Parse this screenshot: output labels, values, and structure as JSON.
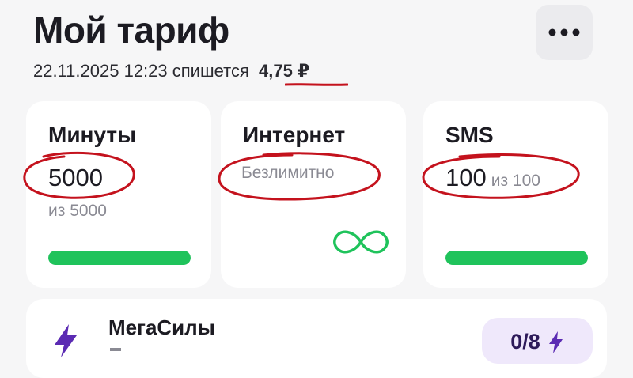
{
  "header": {
    "title": "Мой тариф",
    "more_icon": "more-horizontal-icon"
  },
  "charge": {
    "text": "22.11.2025 12:23 спишется",
    "amount": "4,75 ₽"
  },
  "cards": {
    "minutes": {
      "title": "Минуты",
      "value": "5000",
      "of_text": "из 5000",
      "progress": 1.0
    },
    "internet": {
      "title": "Интернет",
      "status": "Безлимитно",
      "icon": "infinity-icon"
    },
    "sms": {
      "title": "SMS",
      "value": "100",
      "of_text": "из 100",
      "progress": 1.0
    }
  },
  "megasily": {
    "title": "МегаСилы",
    "badge": "0/8",
    "icon": "lightning-icon"
  },
  "colors": {
    "background": "#f6f6f7",
    "card": "#ffffff",
    "progress": "#1fc35b",
    "brand_purple": "#5b2bb3",
    "annotation_red": "#c4121d",
    "muted_text": "#8a8a93"
  }
}
